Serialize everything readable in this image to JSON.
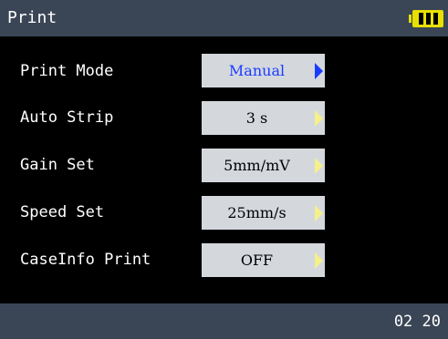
{
  "header": {
    "title": "Print",
    "battery": {
      "level": "full",
      "icon": "battery-icon",
      "color": "#e8e000"
    }
  },
  "settings": [
    {
      "label": "Print Mode",
      "value": "Manual",
      "selected": true
    },
    {
      "label": "Auto Strip",
      "value": "3 s",
      "selected": false
    },
    {
      "label": "Gain Set",
      "value": "5mm/mV",
      "selected": false
    },
    {
      "label": "Speed Set",
      "value": "25mm/s",
      "selected": false
    },
    {
      "label": "CaseInfo Print",
      "value": "OFF",
      "selected": false
    }
  ],
  "footer": {
    "time": "02 20"
  },
  "colors": {
    "bar_bg": "#3a4656",
    "button_bg": "#d4d8dd",
    "selected_text": "#1a3bff",
    "arrow": "#f5f08a"
  }
}
